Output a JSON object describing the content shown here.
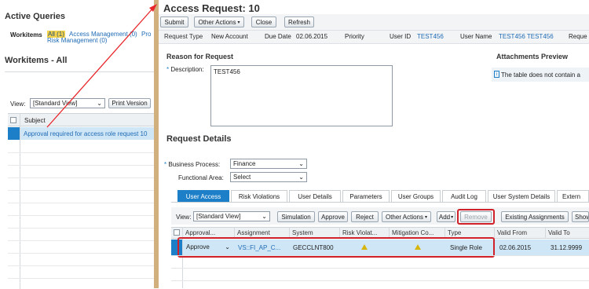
{
  "left": {
    "active_queries_title": "Active Queries",
    "workitems_label": "Workitems",
    "queries": [
      "All (1)",
      "Access Management (0)",
      "Pro",
      "Risk Management (0)"
    ],
    "workitems_title": "Workitems - All",
    "view_label": "View:",
    "view_value": "[Standard View]",
    "print_version_label": "Print Version",
    "subject_header": "Subject",
    "selected_row": "Approval required for access role request 10"
  },
  "header": {
    "title": "Access Request:  10",
    "buttons": [
      "Submit",
      "Other Actions",
      "Close",
      "Refresh"
    ]
  },
  "info": {
    "request_type_label": "Request Type",
    "request_type_value": "New Account",
    "due_date_label": "Due Date",
    "due_date_value": "02.06.2015",
    "priority_label": "Priority",
    "user_id_label": "User ID",
    "user_id_value": "TEST456",
    "user_name_label": "User Name",
    "user_name_value": "TEST456 TEST456",
    "reque_label": "Reque"
  },
  "reason": {
    "title": "Reason for Request",
    "description_label": "Description:",
    "description_value": "TEST456"
  },
  "attachments": {
    "title": "Attachments Preview",
    "message": "The table does not contain a"
  },
  "details": {
    "title": "Request Details",
    "business_process_label": "Business Process:",
    "business_process_value": "Finance",
    "functional_area_label": "Functional Area:",
    "functional_area_value": "Select",
    "tabs": [
      "User Access",
      "Risk Violations",
      "User Details",
      "Parameters",
      "User Groups",
      "Audit Log",
      "User System Details",
      "Extern"
    ]
  },
  "table": {
    "view_label": "View:",
    "view_value": "[Standard View]",
    "buttons": [
      "Simulation",
      "Approve",
      "Reject",
      "Other Actions",
      "Add",
      "Remove",
      "Existing Assignments",
      "Show"
    ],
    "columns": [
      "Approval...",
      "Assignment",
      "System",
      "Risk Violat...",
      "Mitigation Co...",
      "Type",
      "Valid From",
      "Valid To"
    ],
    "row": {
      "approval": "Approve",
      "assignment": "VS::FI_AP_C...",
      "system": "GECCLNT800",
      "type": "Single Role",
      "valid_from": "02.06.2015",
      "valid_to": "31.12.9999"
    }
  },
  "colors": {
    "accent": "#1c7fc7",
    "highlight_border": "#d0202a",
    "splitter": "#d2b07e"
  }
}
